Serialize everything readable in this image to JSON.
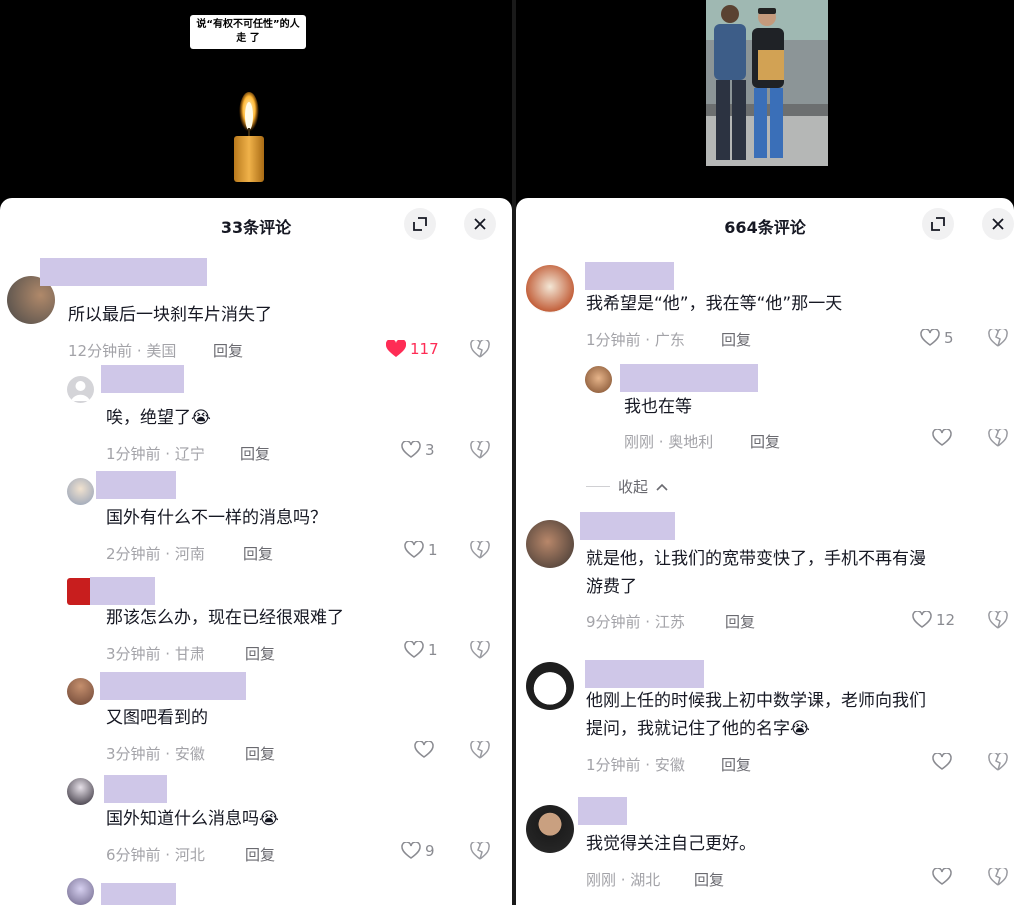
{
  "colors": {
    "name_mask": "#cfc7e8",
    "like_red": "#fe2c55",
    "meta_gray": "#a3a3a8"
  },
  "left": {
    "video_caption_line1": "说“有权不可任性”的人",
    "video_caption_line2": "走 了",
    "comment_count": "33条评论",
    "expand_icon": "expand-icon",
    "close_icon": "close-icon",
    "comments": [
      {
        "text": "所以最后一块刹车片消失了",
        "meta": "12分钟前 · 美国",
        "reply": "回复",
        "likes": "117",
        "liked": true
      },
      {
        "text": "唉，绝望了😭",
        "meta": "1分钟前 · 辽宁",
        "reply": "回复",
        "likes": "3"
      },
      {
        "text": "国外有什么不一样的消息吗？",
        "meta": "2分钟前 · 河南",
        "reply": "回复",
        "likes": "1"
      },
      {
        "text": "那该怎么办，现在已经很艰难了",
        "meta": "3分钟前 · 甘肃",
        "reply": "回复",
        "likes": "1"
      },
      {
        "text": "又图吧看到的",
        "meta": "3分钟前 · 安徽",
        "reply": "回复",
        "likes": ""
      },
      {
        "text": "国外知道什么消息吗😭",
        "meta": "6分钟前 · 河北",
        "reply": "回复",
        "likes": "9"
      }
    ]
  },
  "right": {
    "comment_count": "664条评论",
    "collapse_label": "收起",
    "comments": [
      {
        "text": "我希望是“他”，我在等“他”那一天",
        "meta": "1分钟前 · 广东",
        "reply": "回复",
        "likes": "5"
      },
      {
        "text": "我也在等",
        "meta": "刚刚 · 奥地利",
        "reply": "回复",
        "likes": ""
      },
      {
        "text_line1": "就是他，让我们的宽带变快了，手机不再有漫",
        "text_line2": "游费了",
        "meta": "9分钟前 · 江苏",
        "reply": "回复",
        "likes": "12"
      },
      {
        "text_line1": "他刚上任的时候我上初中数学课，老师向我们",
        "text_line2": "提问，我就记住了他的名字😭",
        "meta": "1分钟前 · 安徽",
        "reply": "回复",
        "likes": ""
      },
      {
        "text": "我觉得关注自己更好。",
        "meta": "刚刚 · 湖北",
        "reply": "回复",
        "likes": ""
      }
    ]
  }
}
